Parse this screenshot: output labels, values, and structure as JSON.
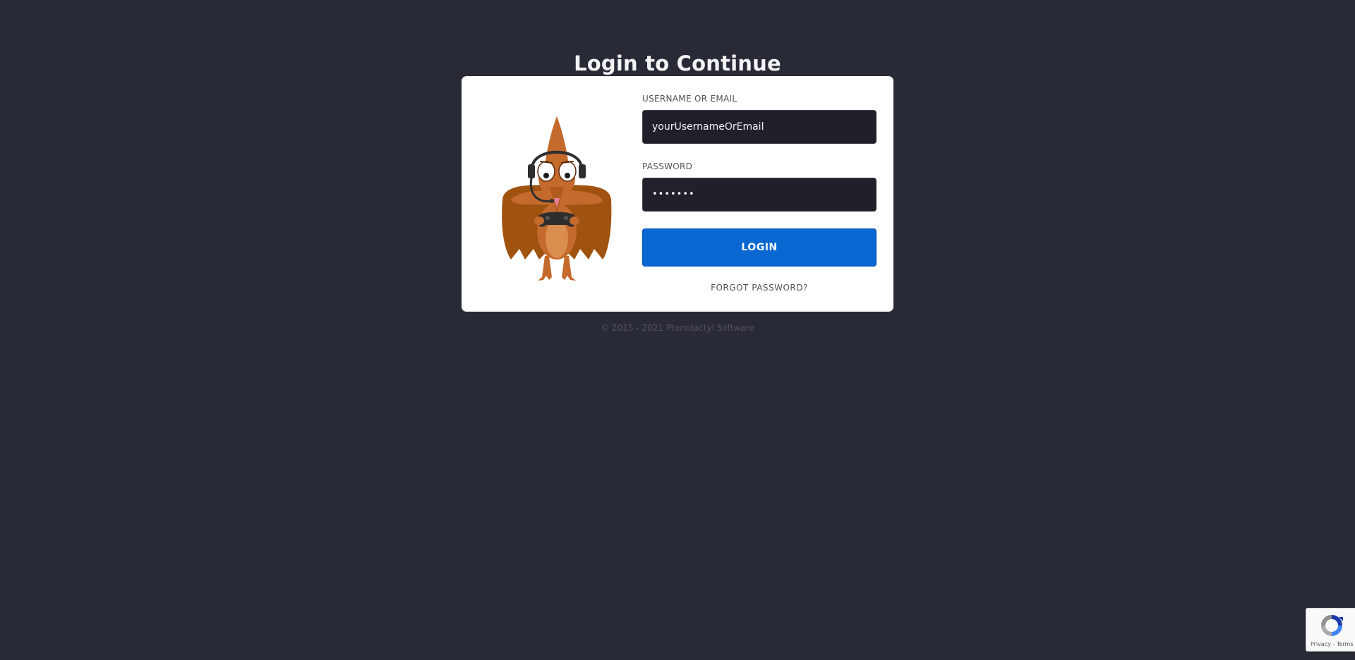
{
  "page": {
    "title": "Login to Continue",
    "footer": "© 2015 - 2021 Pterodactyl Software"
  },
  "form": {
    "username_label": "Username or Email",
    "username_value": "yourUsernameOrEmail",
    "password_label": "Password",
    "password_value": "•••••••",
    "login_label": "Login",
    "forgot_label": "Forgot password?"
  },
  "recaptcha": {
    "privacy": "Privacy",
    "separator": " - ",
    "terms": "Terms"
  },
  "icons": {
    "mascot": "pterodactyl-mascot-icon",
    "recaptcha": "recaptcha-icon"
  },
  "colors": {
    "background": "#282a36",
    "card": "#ffffff",
    "input": "#1f2029",
    "primary_button": "#0967d2"
  }
}
